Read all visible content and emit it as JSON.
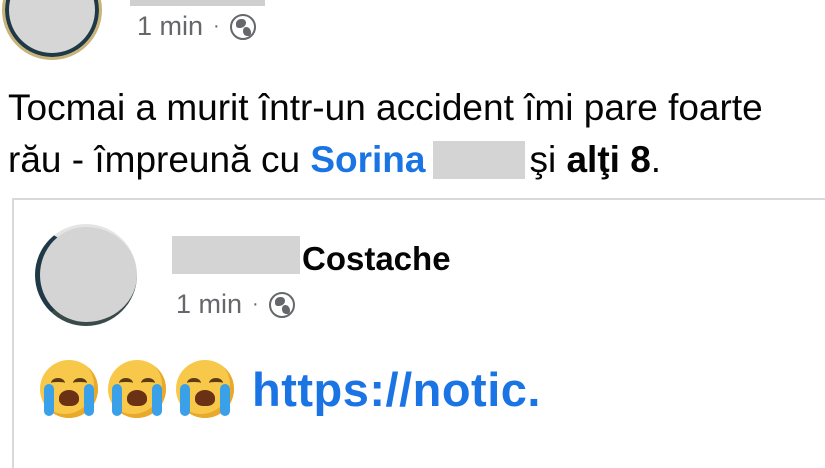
{
  "post": {
    "time": "1 min",
    "separator": "·",
    "text_before": "Tocmai a murit într-un accident îmi pare foarte rău - împreună cu ",
    "mention": "Sorina",
    "text_and": "şi",
    "others": "alţi 8",
    "text_end": "."
  },
  "shared": {
    "author_name": "Costache",
    "time": "1 min",
    "separator": "·",
    "emojis": [
      "crying-face",
      "crying-face",
      "crying-face"
    ],
    "link_text": "https://notic."
  },
  "icons": {
    "privacy": "globe-icon"
  },
  "colors": {
    "link": "#1b74e4",
    "meta": "#65676b",
    "text": "#050505"
  }
}
